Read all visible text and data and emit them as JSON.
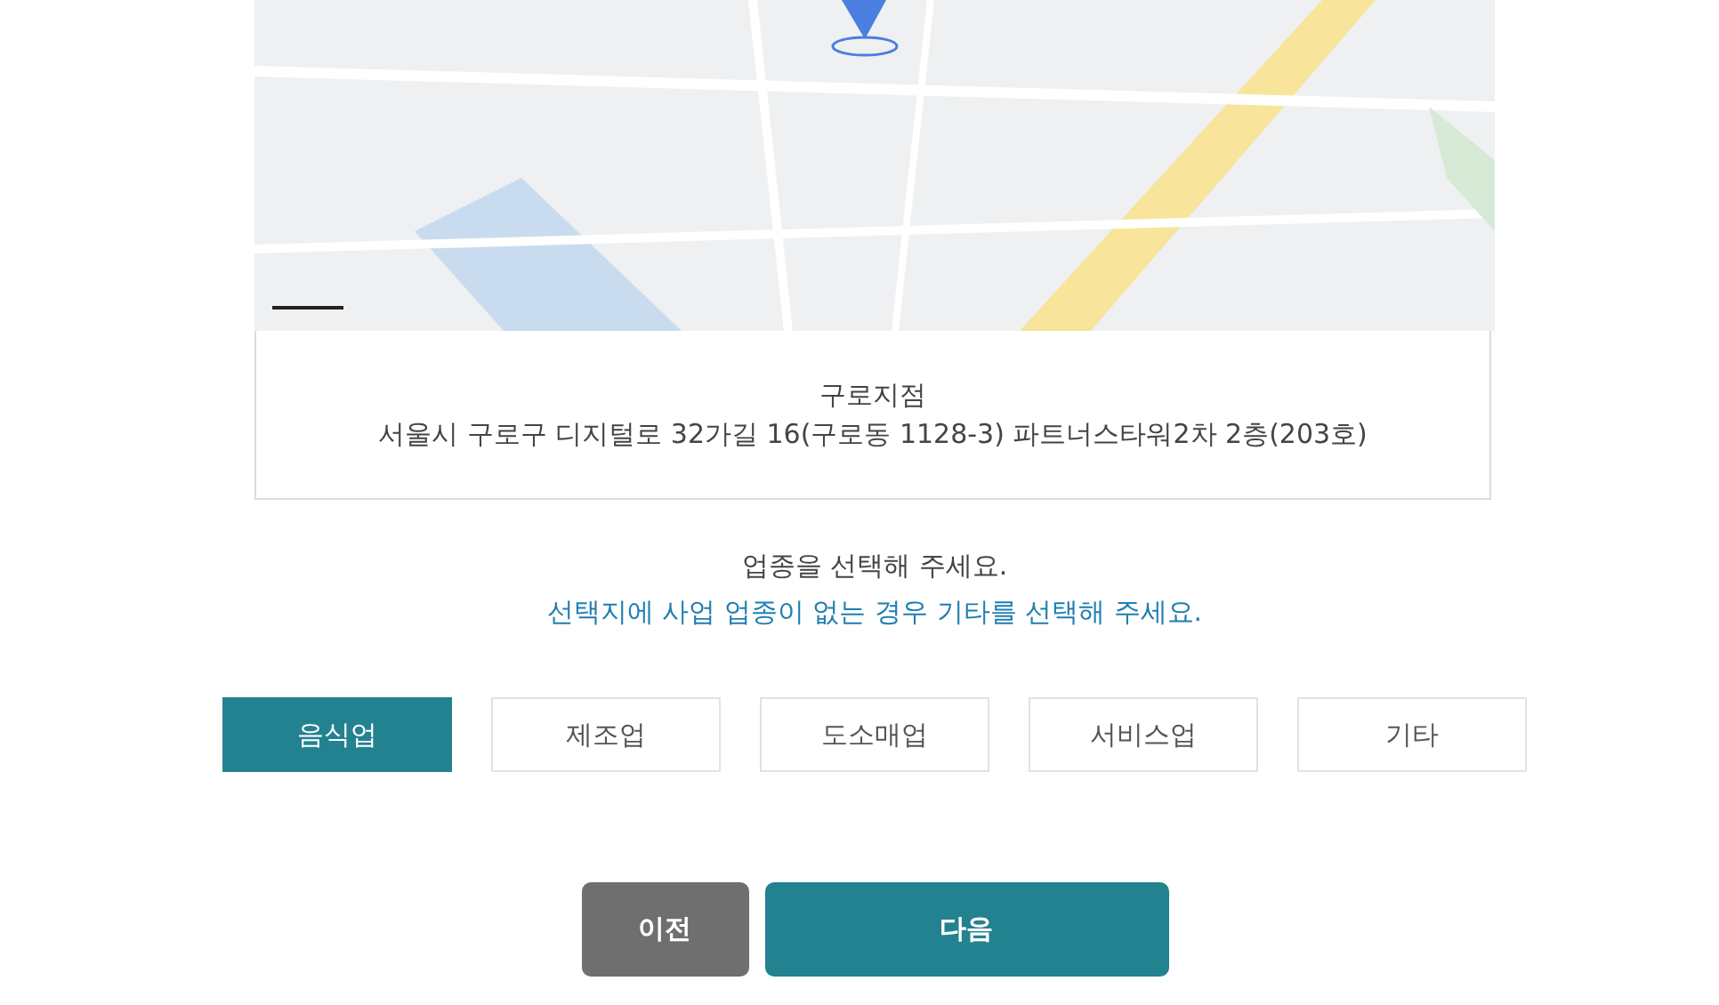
{
  "location": {
    "name": "구로지점",
    "address": "서울시 구로구 디지털로 32가길 16(구로동 1128-3) 파트너스타워2차 2층(203호)"
  },
  "prompt": {
    "title": "업종을 선택해 주세요.",
    "hint": "선택지에 사업 업종이 없는 경우 기타를 선택해 주세요."
  },
  "categories": [
    {
      "label": "음식업",
      "selected": true
    },
    {
      "label": "제조업",
      "selected": false
    },
    {
      "label": "도소매업",
      "selected": false
    },
    {
      "label": "서비스업",
      "selected": false
    },
    {
      "label": "기타",
      "selected": false
    }
  ],
  "buttons": [
    {
      "label": "이전",
      "kind": "secondary"
    },
    {
      "label": "다음",
      "kind": "primary"
    }
  ]
}
